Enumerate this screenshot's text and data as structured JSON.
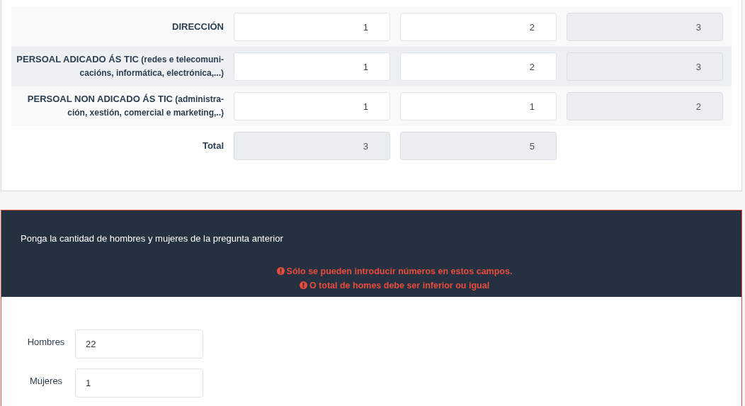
{
  "table": {
    "rows": [
      {
        "label": "DIRECCIÓN",
        "cells": [
          {
            "value": "1",
            "readonly": false
          },
          {
            "value": "2",
            "readonly": false
          },
          {
            "value": "3",
            "readonly": true
          }
        ]
      },
      {
        "label": "PERSOAL ADICADO ÁS TIC",
        "note": "(redes e telecomuni-cacións, informática, electrónica,...)",
        "cells": [
          {
            "value": "1",
            "readonly": false
          },
          {
            "value": "2",
            "readonly": false
          },
          {
            "value": "3",
            "readonly": true
          }
        ]
      },
      {
        "label": "PERSOAL NON ADICADO ÁS TIC",
        "note": "(administra-ción, xestión, comercial e marketing,..)",
        "cells": [
          {
            "value": "1",
            "readonly": false
          },
          {
            "value": "1",
            "readonly": false
          },
          {
            "value": "2",
            "readonly": true
          }
        ]
      },
      {
        "label": "Total",
        "cells": [
          {
            "value": "3",
            "readonly": true
          },
          {
            "value": "5",
            "readonly": true
          }
        ]
      }
    ]
  },
  "question": {
    "title": "Ponga la cantidad de hombres y mujeres de la pregunta anterior",
    "errors": [
      "Sólo se pueden introducir números en estos campos.",
      "O total de homes debe ser inferior ou igual"
    ],
    "fields": [
      {
        "label": "Hombres",
        "value": "22"
      },
      {
        "label": "Mujeres",
        "value": "1"
      }
    ]
  }
}
